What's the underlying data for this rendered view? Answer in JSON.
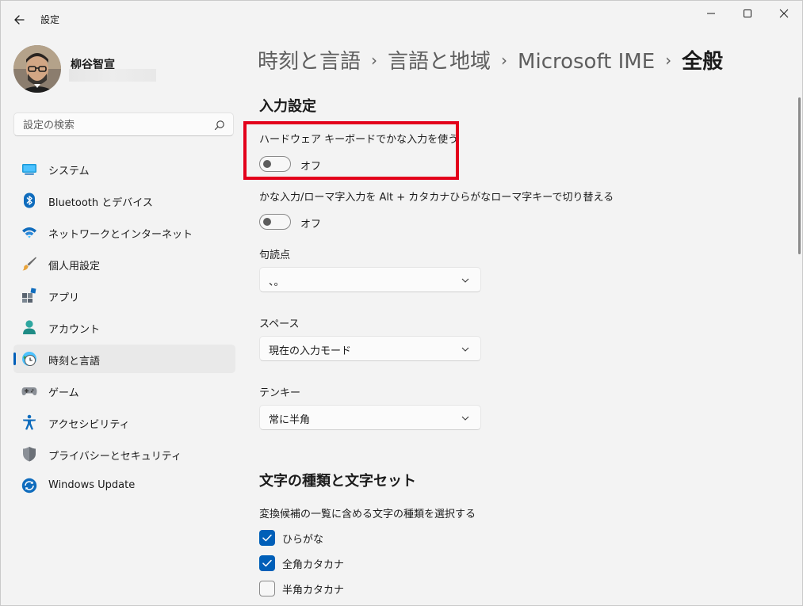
{
  "window": {
    "title": "設定",
    "controls": [
      "minimize-icon",
      "maximize-icon",
      "close-icon"
    ]
  },
  "user": {
    "name": "柳谷智宣"
  },
  "search": {
    "placeholder": "設定の検索",
    "icon": "search-icon"
  },
  "sidebar": {
    "items": [
      {
        "label": "システム",
        "icon": "system-icon",
        "active": false
      },
      {
        "label": "Bluetooth とデバイス",
        "icon": "bluetooth-icon",
        "active": false
      },
      {
        "label": "ネットワークとインターネット",
        "icon": "wifi-icon",
        "active": false
      },
      {
        "label": "個人用設定",
        "icon": "brush-icon",
        "active": false
      },
      {
        "label": "アプリ",
        "icon": "apps-icon",
        "active": false
      },
      {
        "label": "アカウント",
        "icon": "account-icon",
        "active": false
      },
      {
        "label": "時刻と言語",
        "icon": "time-language-icon",
        "active": true
      },
      {
        "label": "ゲーム",
        "icon": "gamepad-icon",
        "active": false
      },
      {
        "label": "アクセシビリティ",
        "icon": "accessibility-icon",
        "active": false
      },
      {
        "label": "プライバシーとセキュリティ",
        "icon": "shield-icon",
        "active": false
      },
      {
        "label": "Windows Update",
        "icon": "update-icon",
        "active": false
      }
    ]
  },
  "breadcrumb": {
    "items": [
      "時刻と言語",
      "言語と地域",
      "Microsoft IME",
      "全般"
    ],
    "separator": "›"
  },
  "main": {
    "input_section": {
      "title": "入力設定",
      "hardware_kana": {
        "label": "ハードウェア キーボードでかな入力を使う",
        "state": "オフ",
        "on": false
      },
      "kana_romaji_switch": {
        "label": "かな入力/ローマ字入力を Alt + カタカナひらがなローマ字キーで切り替える",
        "state": "オフ",
        "on": false
      },
      "punctuation": {
        "label": "句読点",
        "value": "、。"
      },
      "space": {
        "label": "スペース",
        "value": "現在の入力モード"
      },
      "tenkey": {
        "label": "テンキー",
        "value": "常に半角"
      }
    },
    "charset_section": {
      "title": "文字の種類と文字セット",
      "description": "変換候補の一覧に含める文字の種類を選択する",
      "options": [
        {
          "label": "ひらがな",
          "checked": true
        },
        {
          "label": "全角カタカナ",
          "checked": true
        },
        {
          "label": "半角カタカナ",
          "checked": false
        }
      ]
    }
  },
  "colors": {
    "accent": "#005fb8",
    "highlight": "#e3001b",
    "background": "#f3f3f3"
  }
}
